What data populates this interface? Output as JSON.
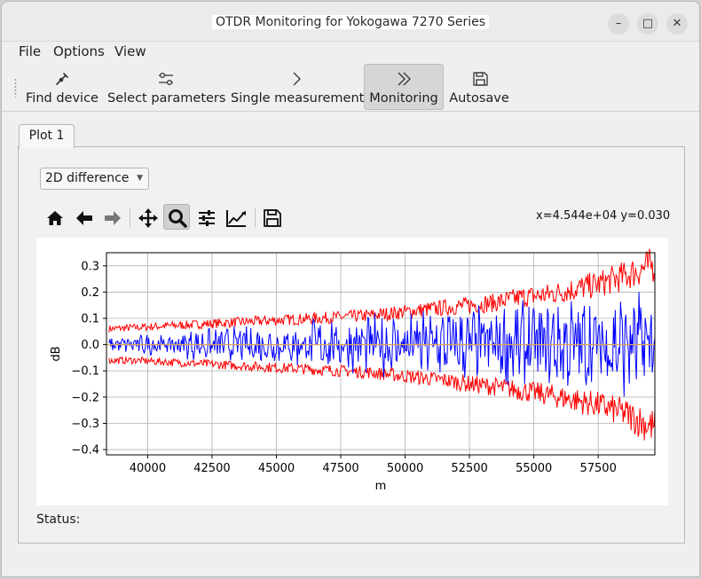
{
  "window": {
    "title": "OTDR Monitoring for Yokogawa 7270 Series"
  },
  "menu": [
    {
      "id": "file",
      "label": "File"
    },
    {
      "id": "options",
      "label": "Options"
    },
    {
      "id": "view",
      "label": "View"
    }
  ],
  "toolbar": {
    "find_device": "Find device",
    "select_parameters": "Select parameters",
    "single_measurement": "Single measurement",
    "monitoring": "Monitoring",
    "autosave": "Autosave",
    "active": "monitoring"
  },
  "tabs": [
    {
      "label": "Plot 1",
      "selected": true
    }
  ],
  "plot_mode": {
    "selected": "2D difference"
  },
  "plot_toolbar": {
    "tools": [
      "home-icon",
      "back-icon",
      "forward-icon",
      "pan-icon",
      "zoom-icon",
      "configure-subplots-icon",
      "edit-axis-icon",
      "save-figure-icon"
    ],
    "active": "zoom-icon",
    "coords": "x=4.544e+04 y=0.030"
  },
  "status": {
    "label": "Status:",
    "value": ""
  },
  "colors": {
    "envelope": "#ff0000",
    "difference": "#0000ff",
    "zero_line": "#d9a35a",
    "grid": "#b0b0b0"
  },
  "chart_data": {
    "type": "line",
    "title": "",
    "xlabel": "m",
    "ylabel": "dB",
    "xlim": [
      38400,
      59700
    ],
    "ylim": [
      -0.42,
      0.35
    ],
    "x_ticks": [
      40000,
      42500,
      45000,
      47500,
      50000,
      52500,
      55000,
      57500
    ],
    "y_ticks": [
      0.3,
      0.2,
      0.1,
      0.0,
      -0.1,
      -0.2,
      -0.3,
      -0.4
    ],
    "x_tick_labels": [
      "40000",
      "42500",
      "45000",
      "47500",
      "50000",
      "52500",
      "55000",
      "57500"
    ],
    "y_tick_labels": [
      "0.3",
      "0.2",
      "0.1",
      "0.0",
      "−0.1",
      "−0.2",
      "−0.3",
      "−0.4"
    ],
    "grid": true,
    "series": [
      {
        "color": "#ff0000",
        "x": [
          38500,
          39500,
          40500,
          41500,
          42500,
          43500,
          44500,
          45500,
          46500,
          47500,
          48500,
          49500,
          50500,
          51500,
          52500,
          53500,
          54500,
          55500,
          56500,
          57500,
          58500,
          59500
        ],
        "y": [
          0.06,
          0.065,
          0.07,
          0.075,
          0.08,
          0.085,
          0.09,
          0.095,
          0.1,
          0.105,
          0.11,
          0.12,
          0.13,
          0.14,
          0.15,
          0.16,
          0.18,
          0.19,
          0.21,
          0.23,
          0.26,
          0.3
        ]
      },
      {
        "color": "#ff0000",
        "x": [
          38500,
          39500,
          40500,
          41500,
          42500,
          43500,
          44500,
          45500,
          46500,
          47500,
          48500,
          49500,
          50500,
          51500,
          52500,
          53500,
          54500,
          55500,
          56500,
          57500,
          58500,
          59500
        ],
        "y": [
          -0.06,
          -0.06,
          -0.065,
          -0.07,
          -0.075,
          -0.08,
          -0.085,
          -0.09,
          -0.095,
          -0.1,
          -0.105,
          -0.115,
          -0.125,
          -0.135,
          -0.15,
          -0.16,
          -0.175,
          -0.19,
          -0.21,
          -0.23,
          -0.26,
          -0.31
        ]
      },
      {
        "color": "#0000ff",
        "x": [
          38500,
          39500,
          40500,
          41500,
          42500,
          43500,
          44500,
          45500,
          46500,
          47500,
          48500,
          49500,
          50500,
          51500,
          52500,
          53500,
          54500,
          55500,
          56500,
          57500,
          58500,
          59500
        ],
        "y": [
          -0.005,
          0.01,
          -0.015,
          0.02,
          -0.02,
          0.025,
          -0.03,
          0.03,
          -0.035,
          0.035,
          -0.04,
          0.045,
          -0.05,
          0.06,
          -0.07,
          0.08,
          -0.09,
          0.1,
          -0.11,
          0.12,
          -0.12,
          0.06
        ]
      },
      {
        "color": "#d9a35a",
        "x": [
          38400,
          59700
        ],
        "y": [
          0.0,
          0.0
        ]
      }
    ]
  }
}
